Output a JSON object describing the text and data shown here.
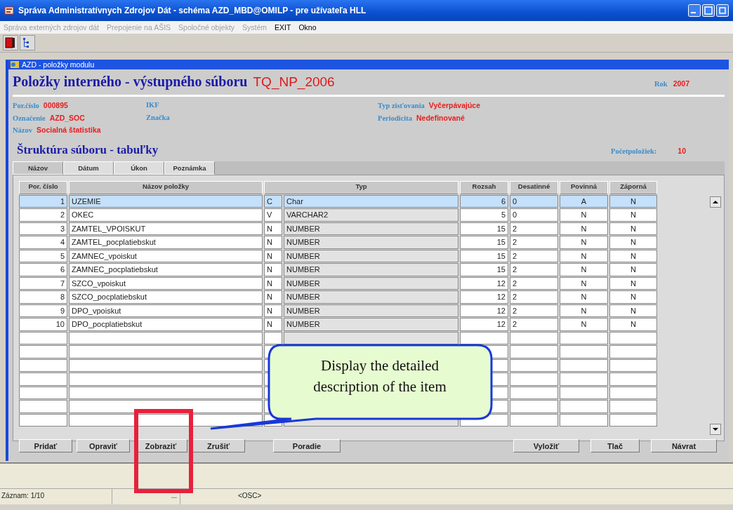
{
  "window": {
    "title": "Správa Administratívnych Zdrojov Dát - schéma AZD_MBD@OMILP - pre užívateľa HLL"
  },
  "menu": [
    {
      "label": "Správa externých zdrojov dát",
      "disabled": true
    },
    {
      "label": "Prepojenie na AŠIS",
      "disabled": true
    },
    {
      "label": "Spoločné objekty",
      "disabled": true
    },
    {
      "label": "Systém",
      "disabled": true
    },
    {
      "label": "EXIT",
      "disabled": false
    },
    {
      "label": "Okno",
      "disabled": false
    }
  ],
  "child_window": {
    "title": "AZD - položky modulu"
  },
  "header": {
    "title": "Položky interného - výstupného súboru",
    "code": "TQ_NP_2006",
    "year_label": "Rok",
    "year": "2007"
  },
  "info": [
    {
      "label": "Por.číslo",
      "value": "000895"
    },
    {
      "label": "IKF"
    },
    {
      "label": "Typ zisťovania",
      "value": "Vyčerpávajúce"
    },
    {
      "label": "Označenie",
      "value": "AZD_SOC"
    },
    {
      "label": "Značka"
    },
    {
      "label": "Periodicita",
      "value": "Nedefinované"
    },
    {
      "label": "Názov",
      "value": "Socialná štatistika"
    }
  ],
  "section": {
    "title": "Štruktúra súboru - tabuľky",
    "count_label": "Početpoložiek:",
    "count": "10"
  },
  "tabs": [
    {
      "label": "Názov",
      "selected": true
    },
    {
      "label": "Dátum",
      "selected": false
    },
    {
      "label": "Úkon",
      "selected": false
    },
    {
      "label": "Poznámka",
      "selected": false
    }
  ],
  "table": {
    "columns": [
      "Por. číslo",
      "Názov položky",
      "Typ",
      "Rozsah",
      "Desatinné",
      "Povinná",
      "Záporná"
    ],
    "rows": [
      {
        "number": "1",
        "name": "UZEMIE",
        "type_code": "C",
        "type": "Char",
        "range": "6",
        "decimals": "0",
        "required": "A",
        "negative": "N",
        "selected": true
      },
      {
        "number": "2",
        "name": "OKEC",
        "type_code": "V",
        "type": "VARCHAR2",
        "range": "5",
        "decimals": "0",
        "required": "N",
        "negative": "N",
        "selected": false
      },
      {
        "number": "3",
        "name": "ZAMTEL_VPOISKUT",
        "type_code": "N",
        "type": "NUMBER",
        "range": "15",
        "decimals": "2",
        "required": "N",
        "negative": "N",
        "selected": false
      },
      {
        "number": "4",
        "name": "ZAMTEL_pocplatiebskut",
        "type_code": "N",
        "type": "NUMBER",
        "range": "15",
        "decimals": "2",
        "required": "N",
        "negative": "N",
        "selected": false
      },
      {
        "number": "5",
        "name": "ZAMNEC_vpoiskut",
        "type_code": "N",
        "type": "NUMBER",
        "range": "15",
        "decimals": "2",
        "required": "N",
        "negative": "N",
        "selected": false
      },
      {
        "number": "6",
        "name": "ZAMNEC_pocplatiebskut",
        "type_code": "N",
        "type": "NUMBER",
        "range": "15",
        "decimals": "2",
        "required": "N",
        "negative": "N",
        "selected": false
      },
      {
        "number": "7",
        "name": "SZCO_vpoiskut",
        "type_code": "N",
        "type": "NUMBER",
        "range": "12",
        "decimals": "2",
        "required": "N",
        "negative": "N",
        "selected": false
      },
      {
        "number": "8",
        "name": "SZCO_pocplatiebskut",
        "type_code": "N",
        "type": "NUMBER",
        "range": "12",
        "decimals": "2",
        "required": "N",
        "negative": "N",
        "selected": false
      },
      {
        "number": "9",
        "name": "DPO_vpoiskut",
        "type_code": "N",
        "type": "NUMBER",
        "range": "12",
        "decimals": "2",
        "required": "N",
        "negative": "N",
        "selected": false
      },
      {
        "number": "10",
        "name": "DPO_pocplatiebskut",
        "type_code": "N",
        "type": "NUMBER",
        "range": "12",
        "decimals": "2",
        "required": "N",
        "negative": "N",
        "selected": false
      }
    ]
  },
  "button_groups": [
    {
      "buttons": [
        "Pridať",
        "Opraviť",
        "Zobraziť",
        "Zrušiť"
      ]
    },
    {
      "buttons": [
        "Poradie"
      ]
    },
    {
      "buttons": [
        "Vyložiť",
        "Tlač",
        "Návrat"
      ]
    }
  ],
  "callout": {
    "text": "Display the detailed description of the item"
  },
  "status_bar": [
    "Záznam: 1/10",
    "...",
    "<OSC>"
  ]
}
